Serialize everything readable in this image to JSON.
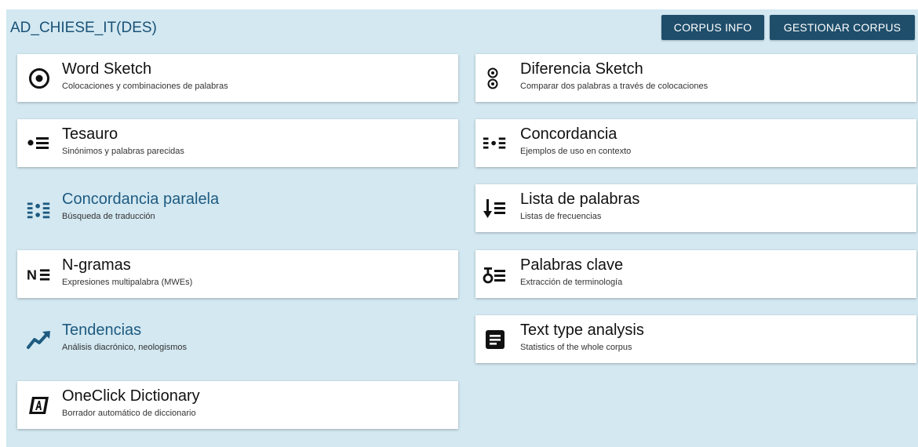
{
  "header": {
    "corpus_name": "AD_CHIESE_IT(DES)",
    "corpus_info_label": "CORPUS INFO",
    "manage_corpus_label": "GESTIONAR CORPUS"
  },
  "tools_left": [
    {
      "title": "Word Sketch",
      "desc": "Colocaciones y combinaciones de palabras",
      "icon": "word-sketch-icon"
    },
    {
      "title": "Tesauro",
      "desc": "Sinónimos y palabras parecidas",
      "icon": "thesaurus-icon"
    },
    {
      "title": "Concordancia paralela",
      "desc": "Búsqueda de traducción",
      "icon": "parallel-concordance-icon"
    },
    {
      "title": "N-gramas",
      "desc": "Expresiones multipalabra (MWEs)",
      "icon": "ngrams-icon"
    },
    {
      "title": "Tendencias",
      "desc": "Análisis diacrónico, neologismos",
      "icon": "trends-icon"
    },
    {
      "title": "OneClick Dictionary",
      "desc": "Borrador automático de diccionario",
      "icon": "oneclick-dictionary-icon"
    }
  ],
  "tools_right": [
    {
      "title": "Diferencia Sketch",
      "desc": "Comparar dos palabras a través de colocaciones",
      "icon": "sketch-difference-icon"
    },
    {
      "title": "Concordancia",
      "desc": "Ejemplos de uso en contexto",
      "icon": "concordance-icon"
    },
    {
      "title": "Lista de palabras",
      "desc": "Listas de frecuencias",
      "icon": "wordlist-icon"
    },
    {
      "title": "Palabras clave",
      "desc": "Extracción de terminología",
      "icon": "keywords-icon"
    },
    {
      "title": "Text type analysis",
      "desc": "Statistics of the whole corpus",
      "icon": "text-type-analysis-icon"
    }
  ],
  "colors": {
    "panel_bg": "#d3e8f1",
    "button_bg": "#1f4e6b",
    "link_title": "#1e5a80"
  }
}
